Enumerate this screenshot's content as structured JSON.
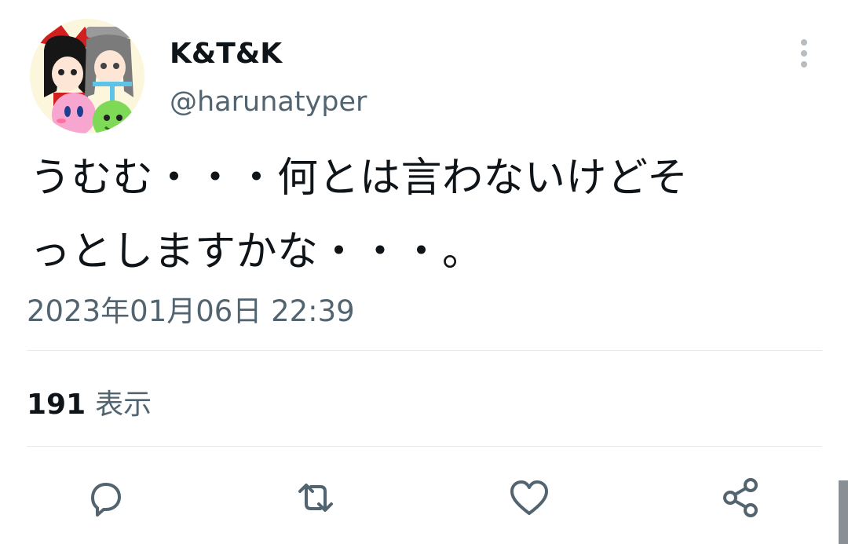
{
  "tweet": {
    "display_name": "K&T&K",
    "handle": "@harunatyper",
    "text": "うむむ・・・何とは言わないけどそ\nっとしますかな・・・。",
    "timestamp": "2023年01月06日 22:39",
    "views_count": "191",
    "views_label": "表示"
  },
  "actions": [
    {
      "name": "reply",
      "icon": "reply-icon"
    },
    {
      "name": "retweet",
      "icon": "retweet-icon"
    },
    {
      "name": "like",
      "icon": "heart-icon"
    },
    {
      "name": "share",
      "icon": "share-icon"
    }
  ],
  "colors": {
    "text_primary": "#0f1419",
    "text_secondary": "#536471",
    "divider": "#e6e8eb",
    "icon": "#536471"
  }
}
